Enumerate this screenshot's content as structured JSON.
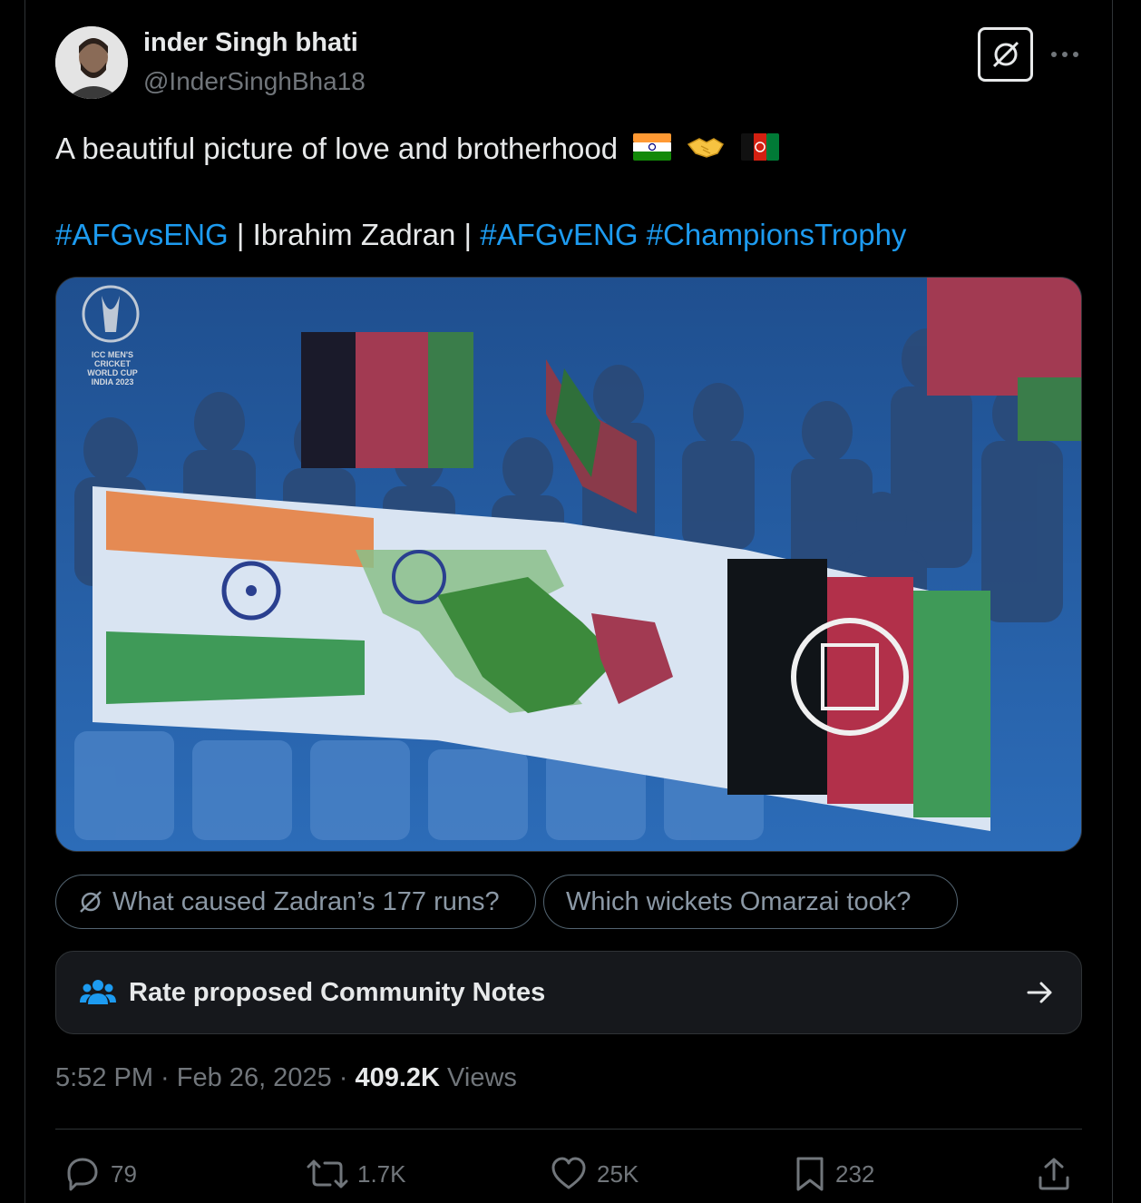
{
  "author": {
    "display_name": "inder Singh bhati",
    "handle": "@InderSinghBha18"
  },
  "tweet": {
    "text_line1": "A beautiful picture of love and brotherhood",
    "emojis": [
      "india-flag",
      "handshake",
      "afghanistan-flag"
    ],
    "hashtag1": "#AFGvsENG",
    "sep1": " | Ibrahim Zadran | ",
    "hashtag2": "#AFGvENG",
    "hashtag3": "#ChampionsTrophy"
  },
  "media": {
    "watermark_lines": [
      "ICC MEN'S",
      "CRICKET",
      "WORLD CUP",
      "INDIA 2023"
    ]
  },
  "grok_suggestions": [
    {
      "label": "What caused Zadran’s 177 runs?",
      "icon": "grok-icon"
    },
    {
      "label": "Which wickets Omarzai took?"
    }
  ],
  "community_notes": {
    "label": "Rate proposed Community Notes"
  },
  "meta": {
    "time": "5:52 PM",
    "dot1": " · ",
    "date": "Feb 26, 2025",
    "dot2": " · ",
    "views_count": "409.2K",
    "views_label": " Views"
  },
  "actions": {
    "replies": "79",
    "reposts": "1.7K",
    "likes": "25K",
    "bookmarks": "232"
  },
  "colors": {
    "background": "#000000",
    "link": "#1d9bf0",
    "muted": "#71767b",
    "text": "#e7e9ea"
  }
}
